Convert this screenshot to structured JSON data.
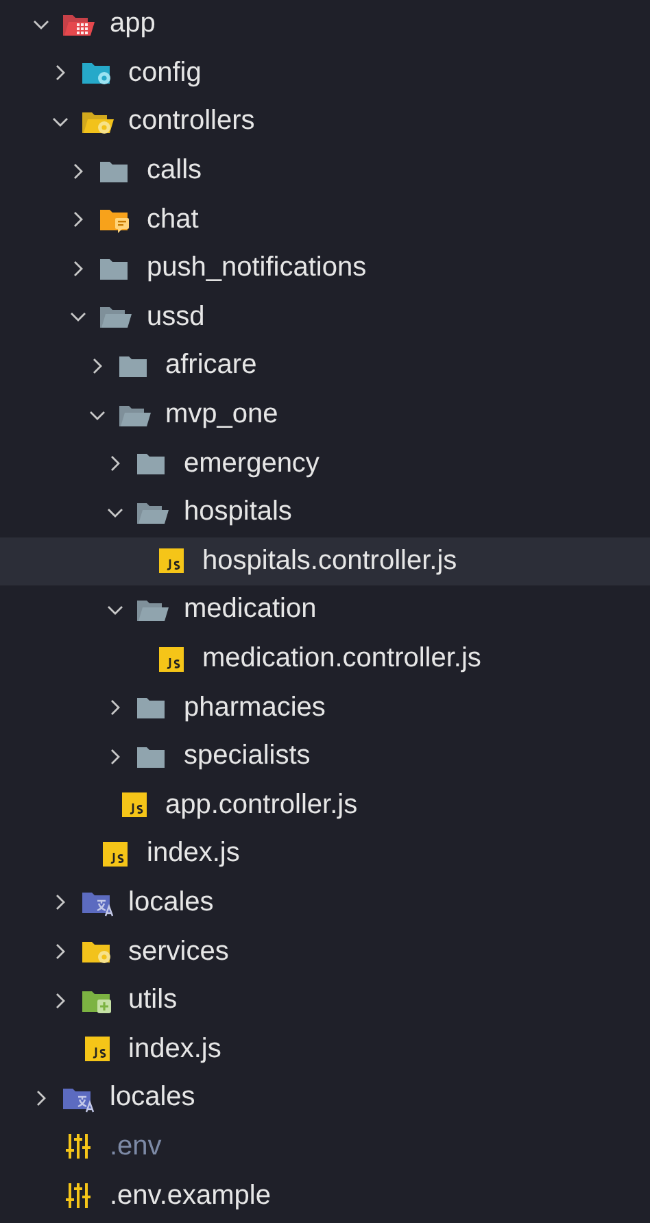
{
  "tree": [
    {
      "name": "app",
      "kind": "app-folder",
      "color": "#e5484d",
      "expanded": true,
      "selected": false,
      "dimmed": false,
      "children": [
        {
          "name": "config",
          "kind": "gear-folder",
          "color": "#26a9c9",
          "expanded": false,
          "selected": false,
          "dimmed": false
        },
        {
          "name": "controllers",
          "kind": "gear-folder",
          "color": "#f2c21b",
          "expanded": true,
          "selected": false,
          "dimmed": false,
          "children": [
            {
              "name": "calls",
              "kind": "folder",
              "color": "#90a4ae",
              "expanded": false,
              "selected": false,
              "dimmed": false
            },
            {
              "name": "chat",
              "kind": "chat-folder",
              "color": "#f7a21b",
              "expanded": false,
              "selected": false,
              "dimmed": false
            },
            {
              "name": "push_notifications",
              "kind": "folder",
              "color": "#90a4ae",
              "expanded": false,
              "selected": false,
              "dimmed": false
            },
            {
              "name": "ussd",
              "kind": "folder",
              "color": "#90a4ae",
              "expanded": true,
              "selected": false,
              "dimmed": false,
              "children": [
                {
                  "name": "africare",
                  "kind": "folder",
                  "color": "#90a4ae",
                  "expanded": false,
                  "selected": false,
                  "dimmed": false
                },
                {
                  "name": "mvp_one",
                  "kind": "folder",
                  "color": "#90a4ae",
                  "expanded": true,
                  "selected": false,
                  "dimmed": false,
                  "children": [
                    {
                      "name": "emergency",
                      "kind": "folder",
                      "color": "#90a4ae",
                      "expanded": false,
                      "selected": false,
                      "dimmed": false
                    },
                    {
                      "name": "hospitals",
                      "kind": "folder",
                      "color": "#90a4ae",
                      "expanded": true,
                      "selected": false,
                      "dimmed": false,
                      "children": [
                        {
                          "name": "hospitals.controller.js",
                          "kind": "js-file",
                          "selected": true,
                          "dimmed": false
                        }
                      ]
                    },
                    {
                      "name": "medication",
                      "kind": "folder",
                      "color": "#90a4ae",
                      "expanded": true,
                      "selected": false,
                      "dimmed": false,
                      "children": [
                        {
                          "name": "medication.controller.js",
                          "kind": "js-file",
                          "selected": false,
                          "dimmed": false
                        }
                      ]
                    },
                    {
                      "name": "pharmacies",
                      "kind": "folder",
                      "color": "#90a4ae",
                      "expanded": false,
                      "selected": false,
                      "dimmed": false
                    },
                    {
                      "name": "specialists",
                      "kind": "folder",
                      "color": "#90a4ae",
                      "expanded": false,
                      "selected": false,
                      "dimmed": false
                    }
                  ]
                },
                {
                  "name": "app.controller.js",
                  "kind": "js-file",
                  "selected": false,
                  "dimmed": false
                }
              ]
            },
            {
              "name": "index.js",
              "kind": "js-file",
              "selected": false,
              "dimmed": false
            }
          ]
        },
        {
          "name": "locales",
          "kind": "locale-folder",
          "color": "#5c6bc0",
          "expanded": false,
          "selected": false,
          "dimmed": false
        },
        {
          "name": "services",
          "kind": "gear-folder",
          "color": "#f2c21b",
          "expanded": false,
          "selected": false,
          "dimmed": false
        },
        {
          "name": "utils",
          "kind": "util-folder",
          "color": "#7cb342",
          "expanded": false,
          "selected": false,
          "dimmed": false
        },
        {
          "name": "index.js",
          "kind": "js-file",
          "selected": false,
          "dimmed": false
        }
      ]
    },
    {
      "name": "locales",
      "kind": "locale-folder",
      "color": "#5c6bc0",
      "expanded": false,
      "selected": false,
      "dimmed": false
    },
    {
      "name": ".env",
      "kind": "env-file",
      "selected": false,
      "dimmed": true
    },
    {
      "name": ".env.example",
      "kind": "env-file",
      "selected": false,
      "dimmed": false
    }
  ]
}
